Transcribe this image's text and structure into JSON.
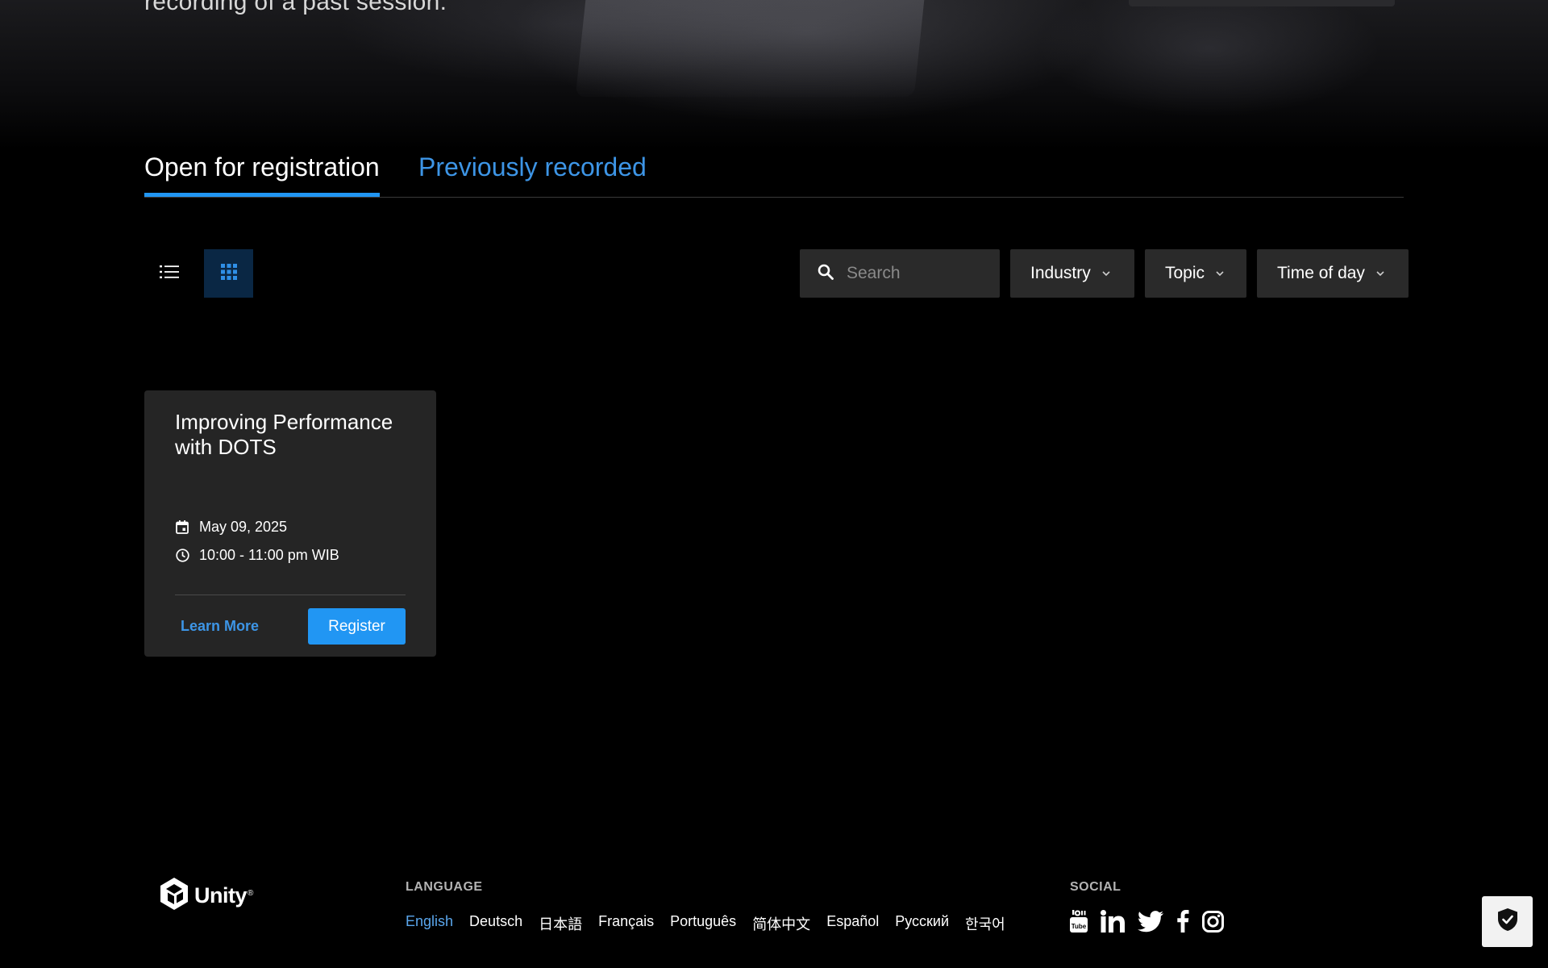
{
  "hero": {
    "subtitle": "recording of a past session."
  },
  "tabs": [
    {
      "label": "Open for registration",
      "active": true
    },
    {
      "label": "Previously recorded",
      "active": false
    }
  ],
  "view_toggle": {
    "list_icon": "list-icon",
    "grid_icon": "grid-icon",
    "selected": "grid"
  },
  "filters": {
    "search_placeholder": "Search",
    "industry_label": "Industry",
    "topic_label": "Topic",
    "time_label": "Time of day"
  },
  "cards": [
    {
      "title": "Improving Performance with DOTS",
      "date": "May 09, 2025",
      "time": "10:00 - 11:00 pm WIB",
      "learn_more_label": "Learn More",
      "register_label": "Register"
    }
  ],
  "footer": {
    "logo_text": "Unity",
    "logo_reg": "®",
    "language_heading": "LANGUAGE",
    "languages": [
      "English",
      "Deutsch",
      "日本語",
      "Français",
      "Português",
      "简体中文",
      "Español",
      "Русский",
      "한국어"
    ],
    "current_language": "English",
    "social_heading": "SOCIAL",
    "social_icons": [
      "youtube-icon",
      "linkedin-icon",
      "twitter-icon",
      "facebook-icon",
      "instagram-icon"
    ]
  },
  "colors": {
    "accent": "#2196f3",
    "link": "#3d95e6",
    "card_bg": "#252525",
    "field_bg": "#2a2a2a",
    "page_bg": "#000000"
  }
}
